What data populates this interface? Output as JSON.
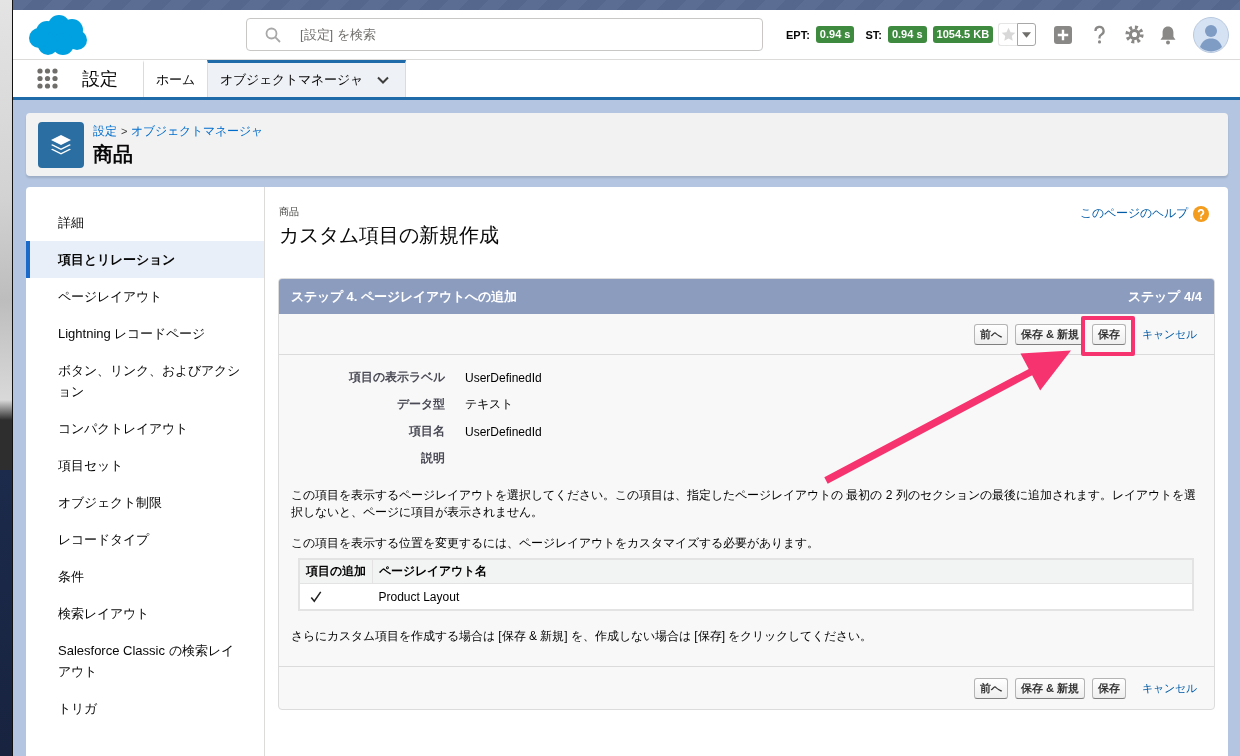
{
  "header": {
    "search": {
      "placeholder": "[設定] を検索"
    },
    "metrics": [
      {
        "label": "EPT:",
        "badges": [
          "0.94 s"
        ]
      },
      {
        "label": "ST:",
        "badges": [
          "0.94 s",
          "1054.5 KB"
        ]
      }
    ]
  },
  "nav": {
    "app_name": "設定",
    "tabs": [
      {
        "label": "ホーム",
        "selected": false,
        "dropdown": false
      },
      {
        "label": "オブジェクトマネージャ",
        "selected": true,
        "dropdown": true
      }
    ]
  },
  "page_header": {
    "breadcrumb": [
      {
        "label": "設定"
      },
      {
        "label": "オブジェクトマネージャ"
      }
    ],
    "separator": ">",
    "title": "商品"
  },
  "sidebar": {
    "items": [
      {
        "label": "詳細",
        "selected": false
      },
      {
        "label": "項目とリレーション",
        "selected": true
      },
      {
        "label": "ページレイアウト",
        "selected": false
      },
      {
        "label": "Lightning レコードページ",
        "selected": false
      },
      {
        "label": "ボタン、リンク、およびアクション",
        "selected": false
      },
      {
        "label": "コンパクトレイアウト",
        "selected": false
      },
      {
        "label": "項目セット",
        "selected": false
      },
      {
        "label": "オブジェクト制限",
        "selected": false
      },
      {
        "label": "レコードタイプ",
        "selected": false
      },
      {
        "label": "条件",
        "selected": false
      },
      {
        "label": "検索レイアウト",
        "selected": false
      },
      {
        "label": "Salesforce Classic の検索レイアウト",
        "selected": false
      },
      {
        "label": "トリガ",
        "selected": false
      }
    ]
  },
  "content": {
    "object_label": "商品",
    "title": "カスタム項目の新規作成",
    "help_link": "このページのヘルプ"
  },
  "wizard": {
    "step_title": "ステップ 4. ページレイアウトへの追加",
    "step_counter": "ステップ 4/4",
    "top_actions": [
      {
        "label": "前へ",
        "kind": "button",
        "highlighted": false
      },
      {
        "label": "保存 & 新規",
        "kind": "button",
        "highlighted": false
      },
      {
        "label": "保存",
        "kind": "button",
        "highlighted": true
      },
      {
        "label": "キャンセル",
        "kind": "link",
        "highlighted": false
      }
    ],
    "fields": [
      {
        "label": "項目の表示ラベル",
        "value": "UserDefinedId"
      },
      {
        "label": "データ型",
        "value": "テキスト"
      },
      {
        "label": "項目名",
        "value": "UserDefinedId"
      },
      {
        "label": "説明"
      }
    ],
    "paragraphs": [
      "この項目を表示するページレイアウトを選択してください。この項目は、指定したページレイアウトの 最初の 2 列のセクションの最後に追加されます。レイアウトを選択しないと、ページに項目が表示されません。",
      "この項目を表示する位置を変更するには、ページレイアウトをカスタマイズする必要があります。"
    ],
    "layout_table": {
      "columns": [
        "項目の追加",
        "ページレイアウト名"
      ],
      "rows": [
        {
          "checked": true,
          "layout_name": "Product Layout"
        }
      ]
    },
    "note": "さらにカスタム項目を作成する場合は [保存 & 新規] を、作成しない場合は [保存] をクリックしてください。",
    "bottom_actions": [
      {
        "label": "前へ",
        "kind": "button",
        "highlighted": false
      },
      {
        "label": "保存 & 新規",
        "kind": "button",
        "highlighted": false
      },
      {
        "label": "保存",
        "kind": "button",
        "highlighted": false
      },
      {
        "label": "キャンセル",
        "kind": "link",
        "highlighted": false
      }
    ]
  }
}
